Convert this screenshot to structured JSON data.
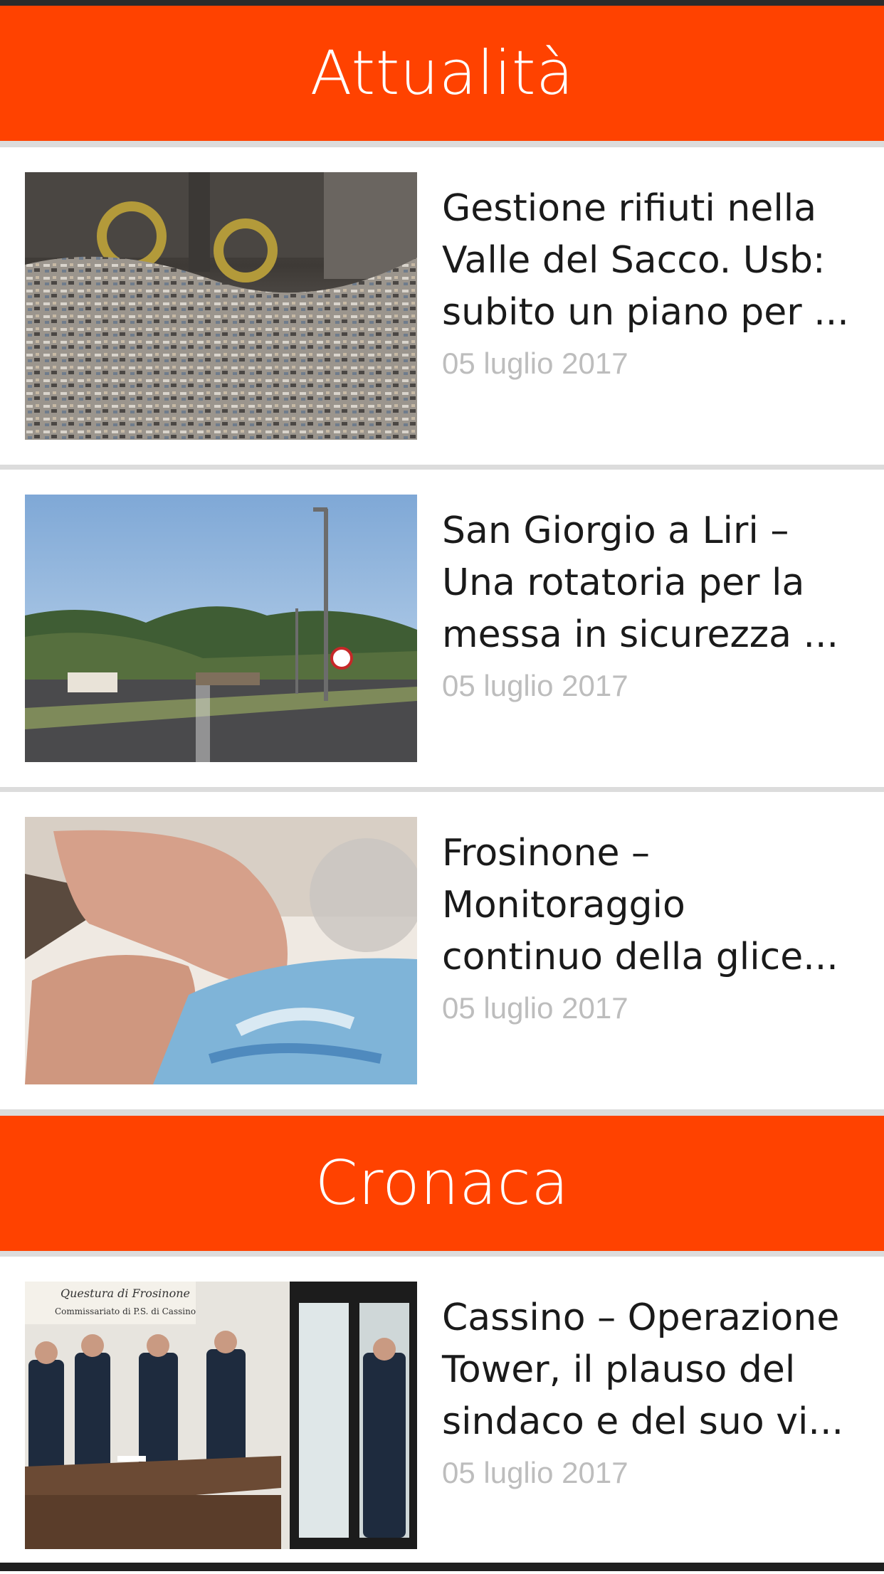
{
  "sections": [
    {
      "header": "Attualità",
      "articles": [
        {
          "title_lines": [
            "Gestione rifiuti nella",
            "Valle del Sacco. Usb:",
            "subito un piano per ..."
          ],
          "date": "05 luglio 2017"
        },
        {
          "title_lines": [
            "San Giorgio a Liri –",
            "Una rotatoria per la",
            "messa in sicurezza ..."
          ],
          "date": "05 luglio 2017"
        },
        {
          "title_lines": [
            "Frosinone –",
            "Monitoraggio",
            "continuo della glice..."
          ],
          "date": "05 luglio 2017"
        }
      ]
    },
    {
      "header": "Cronaca",
      "articles": [
        {
          "title_lines": [
            "Cassino – Operazione",
            "Tower, il plauso del",
            "sindaco e del suo vi..."
          ],
          "date": "05 luglio 2017",
          "image_sign_lines": [
            "Questura di Frosinone",
            "Commissariato di P.S. di Cassino"
          ]
        }
      ]
    }
  ],
  "colors": {
    "header_bg": "#ff4200",
    "header_text": "#ffffff",
    "title_text": "#1a1a1a",
    "date_text": "#bdbdbd",
    "divider": "#dcdcdc"
  }
}
